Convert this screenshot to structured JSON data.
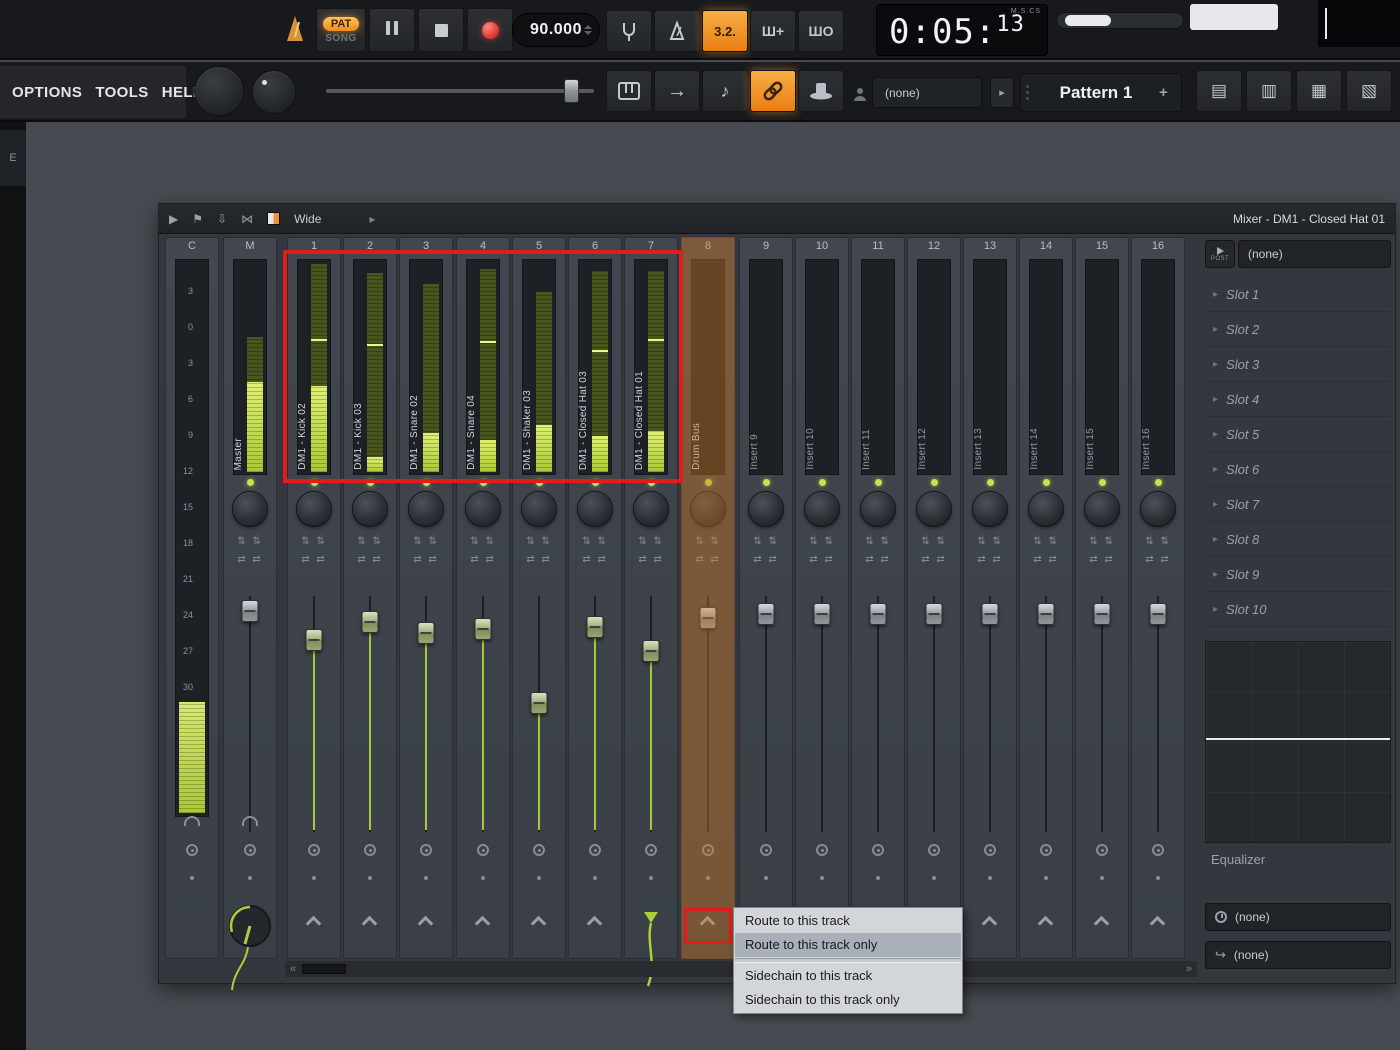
{
  "sidebar": {
    "tab": "E"
  },
  "icons": {
    "updown": "⇅ ⇅",
    "leftright": "⇄ ⇄",
    "slot_arrow": "▸",
    "expander": "▸",
    "next": "▸",
    "scroll_left": "«",
    "scroll_right": "»",
    "play": "▶",
    "flag": "⚑",
    "dock": "⇩",
    "crossfade": "⋈",
    "tool_arrow": "→",
    "tool_note": "♪",
    "step_edit": "Ш+",
    "overdub": "ШO",
    "panel_1": "▤",
    "panel_2": "▥",
    "panel_3": "▦",
    "panel_4": "▧",
    "send_arrow": "↪"
  },
  "transport": {
    "pat_label": "PAT",
    "song_label": "SONG",
    "tempo": "90.000",
    "bar_beat": "3.2.",
    "time_main": "0:05:",
    "time_cs": "13",
    "time_units": "M.S.CS"
  },
  "menubar": {
    "options": "OPTIONS",
    "tools": "TOOLS",
    "help": "HELP"
  },
  "pattern_bar": {
    "picker_value": "(none)",
    "pattern_name": "Pattern 1",
    "add": "+"
  },
  "mixer": {
    "title": "Mixer - DM1 - Closed Hat 01",
    "view_mode": "Wide",
    "db_scale": [
      "3",
      "0",
      "3",
      "6",
      "9",
      "12",
      "15",
      "18",
      "21",
      "24",
      "27",
      "30"
    ],
    "tracks": [
      {
        "num": "C",
        "kind": "current",
        "name": "",
        "meter_fill": 0.2
      },
      {
        "num": "M",
        "kind": "master",
        "name": "Master",
        "meter_dim": 0.63,
        "meter_fill": 0.42,
        "fader": 0.02
      },
      {
        "num": "1",
        "kind": "insert",
        "name": "DM1 - Kick 02",
        "meter_dim": 0.97,
        "meter_fill": 0.4,
        "peak": 0.62,
        "fader": 0.15,
        "green": true
      },
      {
        "num": "2",
        "kind": "insert",
        "name": "DM1 - Kick 03",
        "meter_dim": 0.93,
        "meter_fill": 0.07,
        "peak": 0.6,
        "fader": 0.07,
        "green": true
      },
      {
        "num": "3",
        "kind": "insert",
        "name": "DM1 - Snare 02",
        "meter_dim": 0.88,
        "meter_fill": 0.18,
        "fader": 0.12,
        "green": true
      },
      {
        "num": "4",
        "kind": "insert",
        "name": "DM1 - Snare 04",
        "meter_dim": 0.95,
        "meter_fill": 0.15,
        "peak": 0.61,
        "fader": 0.1,
        "green": true
      },
      {
        "num": "5",
        "kind": "insert",
        "name": "DM1 - Shaker 03",
        "meter_dim": 0.84,
        "meter_fill": 0.22,
        "fader": 0.44,
        "green": true
      },
      {
        "num": "6",
        "kind": "insert",
        "name": "DM1 - Closed Hat 03",
        "meter_dim": 0.94,
        "meter_fill": 0.17,
        "peak": 0.57,
        "fader": 0.09,
        "green": true
      },
      {
        "num": "7",
        "kind": "insert",
        "name": "DM1 - Closed Hat 01",
        "meter_dim": 0.94,
        "meter_fill": 0.19,
        "peak": 0.62,
        "fader": 0.2,
        "green": true,
        "routed": true
      },
      {
        "num": "8",
        "kind": "insert",
        "name": "Drum Bus",
        "fader": 0.05,
        "selected": true
      },
      {
        "num": "9",
        "kind": "insert",
        "name": "Insert 9",
        "fader": 0.03
      },
      {
        "num": "10",
        "kind": "insert",
        "name": "Insert 10",
        "fader": 0.03
      },
      {
        "num": "11",
        "kind": "insert",
        "name": "Insert 11",
        "fader": 0.03
      },
      {
        "num": "12",
        "kind": "insert",
        "name": "Insert 12",
        "fader": 0.03
      },
      {
        "num": "13",
        "kind": "insert",
        "name": "Insert 13",
        "fader": 0.03
      },
      {
        "num": "14",
        "kind": "insert",
        "name": "Insert 14",
        "fader": 0.03
      },
      {
        "num": "15",
        "kind": "insert",
        "name": "Insert 15",
        "fader": 0.03
      },
      {
        "num": "16",
        "kind": "insert",
        "name": "Insert 16",
        "fader": 0.03
      }
    ]
  },
  "rack": {
    "post_label": "POST",
    "top_select": "(none)",
    "slots": [
      "Slot 1",
      "Slot 2",
      "Slot 3",
      "Slot 4",
      "Slot 5",
      "Slot 6",
      "Slot 7",
      "Slot 8",
      "Slot 9",
      "Slot 10"
    ],
    "equalizer_label": "Equalizer",
    "select_a": "(none)",
    "select_b": "(none)"
  },
  "context_menu": {
    "separator_after": 1,
    "items": [
      {
        "label": "Route to this track",
        "selected": false
      },
      {
        "label": "Route to this track only",
        "selected": true
      },
      {
        "label": "Sidechain to this track",
        "selected": false
      },
      {
        "label": "Sidechain to this track only",
        "selected": false
      }
    ]
  },
  "colors": {
    "accent_orange": "#f29a38",
    "meter_green": "#b4d544",
    "highlight_red": "#e01c1c",
    "selected_track_tint": "#d57a20"
  }
}
